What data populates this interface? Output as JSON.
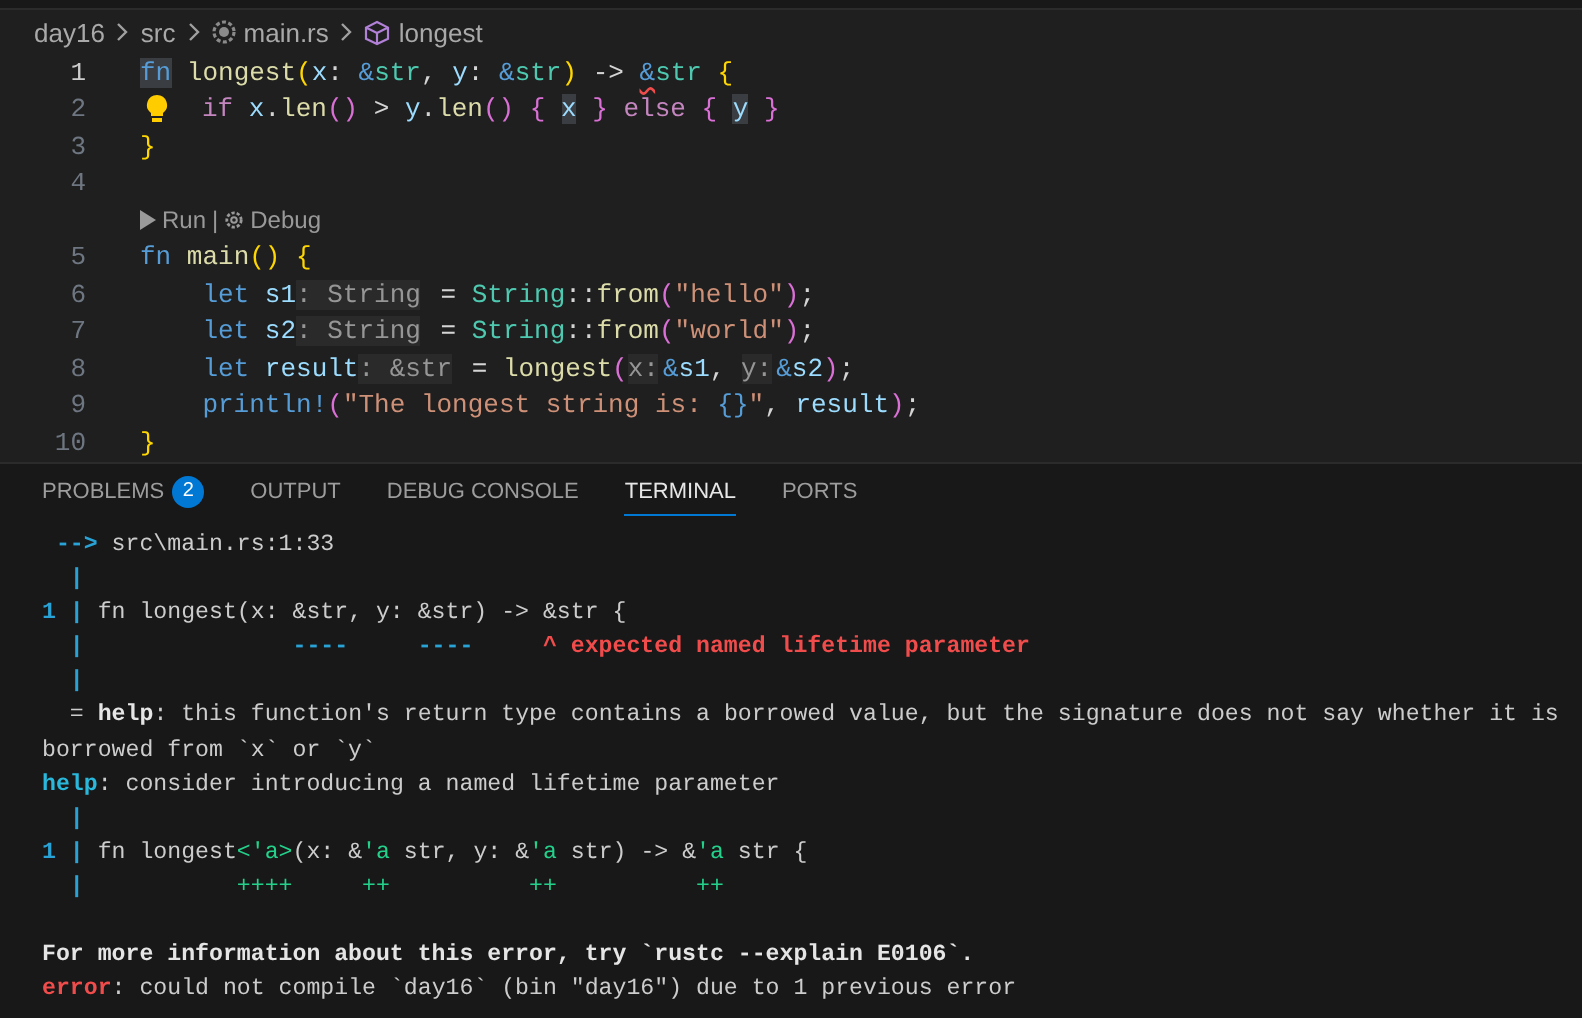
{
  "breadcrumb": [
    {
      "text": "day16",
      "kind": "folder"
    },
    {
      "text": "src",
      "kind": "folder"
    },
    {
      "text": "main.rs",
      "kind": "file"
    },
    {
      "text": "longest",
      "kind": "symbol"
    }
  ],
  "editor": {
    "lines": [
      {
        "kind": "code",
        "number": "1",
        "active": true,
        "lightbulb": false,
        "tokens": [
          {
            "text": "fn",
            "kind": "kw-hl"
          },
          {
            "text": " longest",
            "kind": "fn"
          },
          {
            "text": "(",
            "kind": "b1"
          },
          {
            "text": "x",
            "kind": "var"
          },
          {
            "text": ": ",
            "kind": "plain"
          },
          {
            "text": "&",
            "kind": "kw"
          },
          {
            "text": "str",
            "kind": "type"
          },
          {
            "text": ", ",
            "kind": "plain"
          },
          {
            "text": "y",
            "kind": "var"
          },
          {
            "text": ": ",
            "kind": "plain"
          },
          {
            "text": "&",
            "kind": "kw"
          },
          {
            "text": "str",
            "kind": "type"
          },
          {
            "text": ")",
            "kind": "b1"
          },
          {
            "text": " -> ",
            "kind": "plain"
          },
          {
            "text": "&",
            "kind": "kw-err"
          },
          {
            "text": "str",
            "kind": "type"
          },
          {
            "text": " {",
            "kind": "b1"
          }
        ]
      },
      {
        "kind": "code",
        "number": "2",
        "active": false,
        "lightbulb": true,
        "tokens": [
          {
            "text": "if",
            "kind": "ctl"
          },
          {
            "text": " x",
            "kind": "var"
          },
          {
            "text": ".",
            "kind": "plain"
          },
          {
            "text": "len",
            "kind": "fn"
          },
          {
            "text": "()",
            "kind": "b2"
          },
          {
            "text": " > ",
            "kind": "plain"
          },
          {
            "text": "y",
            "kind": "var"
          },
          {
            "text": ".",
            "kind": "plain"
          },
          {
            "text": "len",
            "kind": "fn"
          },
          {
            "text": "()",
            "kind": "b2"
          },
          {
            "text": " { ",
            "kind": "b2"
          },
          {
            "text": "x",
            "kind": "var-hl"
          },
          {
            "text": " }",
            "kind": "b2"
          },
          {
            "text": " else",
            "kind": "ctl"
          },
          {
            "text": " { ",
            "kind": "b2"
          },
          {
            "text": "y",
            "kind": "var-hl"
          },
          {
            "text": " }",
            "kind": "b2"
          }
        ]
      },
      {
        "kind": "code",
        "number": "3",
        "active": false,
        "lightbulb": false,
        "tokens": [
          {
            "text": "}",
            "kind": "b1"
          }
        ]
      },
      {
        "kind": "code",
        "number": "4",
        "active": false,
        "lightbulb": false
      },
      {
        "kind": "codelens",
        "run": "Run",
        "separator": "|",
        "debug": "Debug"
      },
      {
        "kind": "code",
        "number": "5",
        "active": false,
        "lightbulb": false,
        "tokens": [
          {
            "text": "fn",
            "kind": "kw"
          },
          {
            "text": " main",
            "kind": "fn"
          },
          {
            "text": "()",
            "kind": "b1"
          },
          {
            "text": " {",
            "kind": "b1"
          }
        ]
      },
      {
        "kind": "code",
        "number": "6",
        "active": false,
        "lightbulb": false,
        "tokens": [
          {
            "text": "    let",
            "kind": "kw"
          },
          {
            "text": " s1",
            "kind": "var"
          },
          {
            "text": ": String",
            "kind": "hint"
          },
          {
            "text": " = ",
            "kind": "plain"
          },
          {
            "text": "String",
            "kind": "type"
          },
          {
            "text": "::",
            "kind": "plain"
          },
          {
            "text": "from",
            "kind": "fn"
          },
          {
            "text": "(",
            "kind": "b2"
          },
          {
            "text": "\"hello\"",
            "kind": "str"
          },
          {
            "text": ")",
            "kind": "b2"
          },
          {
            "text": ";",
            "kind": "plain"
          }
        ]
      },
      {
        "kind": "code",
        "number": "7",
        "active": false,
        "lightbulb": false,
        "tokens": [
          {
            "text": "    let",
            "kind": "kw"
          },
          {
            "text": " s2",
            "kind": "var"
          },
          {
            "text": ": String",
            "kind": "hint"
          },
          {
            "text": " = ",
            "kind": "plain"
          },
          {
            "text": "String",
            "kind": "type"
          },
          {
            "text": "::",
            "kind": "plain"
          },
          {
            "text": "from",
            "kind": "fn"
          },
          {
            "text": "(",
            "kind": "b2"
          },
          {
            "text": "\"world\"",
            "kind": "str"
          },
          {
            "text": ")",
            "kind": "b2"
          },
          {
            "text": ";",
            "kind": "plain"
          }
        ]
      },
      {
        "kind": "code",
        "number": "8",
        "active": false,
        "lightbulb": false,
        "tokens": [
          {
            "text": "    let",
            "kind": "kw"
          },
          {
            "text": " result",
            "kind": "var"
          },
          {
            "text": ": &str",
            "kind": "hint"
          },
          {
            "text": " = ",
            "kind": "plain"
          },
          {
            "text": "longest",
            "kind": "fn"
          },
          {
            "text": "(",
            "kind": "b2"
          },
          {
            "text": "x:",
            "kind": "hint"
          },
          {
            "text": "&",
            "kind": "kw"
          },
          {
            "text": "s1",
            "kind": "var"
          },
          {
            "text": ", ",
            "kind": "plain"
          },
          {
            "text": "y:",
            "kind": "hint"
          },
          {
            "text": "&",
            "kind": "kw"
          },
          {
            "text": "s2",
            "kind": "var"
          },
          {
            "text": ")",
            "kind": "b2"
          },
          {
            "text": ";",
            "kind": "plain"
          }
        ]
      },
      {
        "kind": "code",
        "number": "9",
        "active": false,
        "lightbulb": false,
        "tokens": [
          {
            "text": "    println!",
            "kind": "kw"
          },
          {
            "text": "(",
            "kind": "b2"
          },
          {
            "text": "\"The longest string is: ",
            "kind": "str"
          },
          {
            "text": "{}",
            "kind": "kw"
          },
          {
            "text": "\"",
            "kind": "str"
          },
          {
            "text": ", ",
            "kind": "plain"
          },
          {
            "text": "result",
            "kind": "var"
          },
          {
            "text": ")",
            "kind": "b2"
          },
          {
            "text": ";",
            "kind": "plain"
          }
        ]
      },
      {
        "kind": "code",
        "number": "10",
        "active": false,
        "lightbulb": false,
        "tokens": [
          {
            "text": "}",
            "kind": "b1"
          }
        ]
      }
    ]
  },
  "panel": {
    "tabs": [
      {
        "label": "PROBLEMS",
        "badge": "2",
        "selected": false
      },
      {
        "label": "OUTPUT",
        "selected": false
      },
      {
        "label": "DEBUG CONSOLE",
        "selected": false
      },
      {
        "label": "TERMINAL",
        "selected": true
      },
      {
        "label": "PORTS",
        "selected": false
      }
    ],
    "terminal": {
      "diagnostic": [
        [
          {
            "text": " -->",
            "kind": "blue"
          },
          {
            "text": " src\\main.rs:1:33",
            "kind": "plain"
          }
        ],
        [
          {
            "text": "  |",
            "kind": "blue"
          }
        ],
        [
          {
            "text": "1 |",
            "kind": "blue"
          },
          {
            "text": " fn longest(x: &str, y: &str) -> &str {",
            "kind": "plain"
          }
        ],
        [
          {
            "text": "  |",
            "kind": "blue"
          },
          {
            "text": "               ----     ----     ",
            "kind": "blue"
          },
          {
            "text": "^ expected named lifetime parameter",
            "kind": "red"
          }
        ],
        [
          {
            "text": "  |",
            "kind": "blue"
          }
        ],
        [
          {
            "text": "  = ",
            "kind": "plain"
          },
          {
            "text": "help",
            "kind": "bold"
          },
          {
            "text": ": this function's return type contains a borrowed value, but the signature does not say whether it is",
            "kind": "plain"
          }
        ],
        [
          {
            "text": "borrowed from `x` or `y`",
            "kind": "plain"
          }
        ],
        [
          {
            "text": "help",
            "kind": "cyan"
          },
          {
            "text": ": consider introducing a named lifetime parameter",
            "kind": "plain"
          }
        ],
        [
          {
            "text": "  |",
            "kind": "blue"
          }
        ],
        [
          {
            "text": "1 |",
            "kind": "blue"
          },
          {
            "text": " fn longest",
            "kind": "plain"
          },
          {
            "text": "<'a>",
            "kind": "green"
          },
          {
            "text": "(x: &",
            "kind": "plain"
          },
          {
            "text": "'a",
            "kind": "green"
          },
          {
            "text": " str, y: &",
            "kind": "plain"
          },
          {
            "text": "'a",
            "kind": "green"
          },
          {
            "text": " str) -> &",
            "kind": "plain"
          },
          {
            "text": "'a",
            "kind": "green"
          },
          {
            "text": " str {",
            "kind": "plain"
          }
        ],
        [
          {
            "text": "  |",
            "kind": "blue"
          },
          {
            "text": "           ++++     ++          ++          ++",
            "kind": "green"
          }
        ]
      ],
      "summary": [
        [
          {
            "text": "For more information about this error, try `rustc --explain E0106`.",
            "kind": "bold"
          }
        ],
        [
          {
            "text": "error",
            "kind": "red"
          },
          {
            "text": ": could not compile `day16` (bin \"day16\") due to 1 previous error",
            "kind": "plain"
          }
        ]
      ]
    }
  }
}
